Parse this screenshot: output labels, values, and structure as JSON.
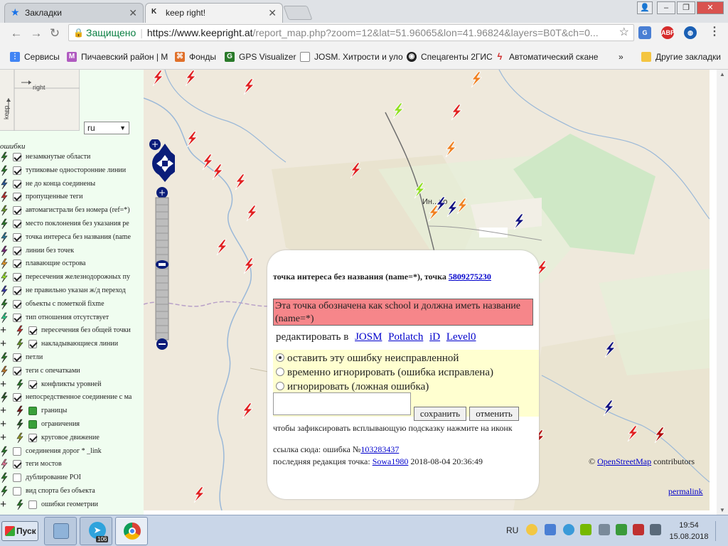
{
  "browser": {
    "tabs": [
      {
        "label": "Закладки",
        "active": false
      },
      {
        "label": "keep right!",
        "active": true
      }
    ],
    "window_controls": [
      "–",
      "❐",
      "✕"
    ],
    "omnibox": {
      "secure_label": "Защищено",
      "url_host": "https://www.keepright.at",
      "url_path": "/report_map.php?zoom=12&lat=51.96065&lon=41.96824&layers=B0T&ch=0..."
    },
    "extensions": [
      "ABP"
    ],
    "bookmarks": [
      {
        "label": "Сервисы",
        "icon": "apps-icon"
      },
      {
        "label": "Пичаевский район | М",
        "icon": "m-icon"
      },
      {
        "label": "Фонды",
        "icon": "funds-icon"
      },
      {
        "label": "GPS Visualizer",
        "icon": "g-icon"
      },
      {
        "label": "JOSM. Хитрости и уло",
        "icon": "doc-icon"
      },
      {
        "label": "Спецагенты 2ГИС",
        "icon": "spy-icon"
      },
      {
        "label": "Автоматический скане",
        "icon": "bolt-icon"
      }
    ],
    "bookmarks_more": "»",
    "other_bookmarks": "Другие закладки"
  },
  "sidebar": {
    "minimap_label": "right",
    "minimap_label2": "keep",
    "language": "ru",
    "errors_header": "ошибки",
    "errors": [
      {
        "label": "незамкнутые области",
        "color": "#2a7a2a",
        "checked": true,
        "plus": false
      },
      {
        "label": "тупиковые односторонние линии",
        "color": "#2a7a2a",
        "checked": true,
        "plus": false
      },
      {
        "label": "не до конца соединены",
        "color": "#2a5a9a",
        "checked": true,
        "plus": false
      },
      {
        "label": "пропущенные теги",
        "color": "#c03030",
        "checked": true,
        "plus": false
      },
      {
        "label": "автомагистрали без номера (ref=*)",
        "color": "#6a9a2a",
        "checked": true,
        "plus": false
      },
      {
        "label": "место поклонения без указания ре",
        "color": "#2a7a2a",
        "checked": true,
        "plus": false
      },
      {
        "label": "точка интереса без названия (name",
        "color": "#2a7a9a",
        "checked": true,
        "plus": false
      },
      {
        "label": "линии без точек",
        "color": "#7a2a7a",
        "checked": true,
        "plus": false
      },
      {
        "label": "плавающие острова",
        "color": "#e89a2a",
        "checked": true,
        "plus": false
      },
      {
        "label": "пересечения железнодорожных пу",
        "color": "#9ae82a",
        "checked": true,
        "plus": false
      },
      {
        "label": "не правильно указан ж/д переход",
        "color": "#3a3aaa",
        "checked": true,
        "plus": false
      },
      {
        "label": "объекты с пометкой fixme",
        "color": "#2a7a2a",
        "checked": true,
        "plus": false
      },
      {
        "label": "тип отношения отсутствует",
        "color": "#2ad08a",
        "checked": true,
        "plus": false
      },
      {
        "label": "пересечения без общей точки",
        "color": "#c03030",
        "checked": true,
        "plus": true
      },
      {
        "label": "накладывающиеся линии",
        "color": "#6a9a2a",
        "checked": true,
        "plus": true
      },
      {
        "label": "петли",
        "color": "#2a7a2a",
        "checked": true,
        "plus": false
      },
      {
        "label": "теги с опечатками",
        "color": "#c07a2a",
        "checked": true,
        "plus": false
      },
      {
        "label": "конфликты уровней",
        "color": "#2a7a2a",
        "checked": true,
        "plus": true
      },
      {
        "label": "непосредственное соединение с ма",
        "color": "#2a5a2a",
        "checked": true,
        "plus": false
      },
      {
        "label": "границы",
        "color": "#7a1a1a",
        "checked": true,
        "plus": true,
        "filled": true
      },
      {
        "label": "ограничения",
        "color": "#2a5a2a",
        "checked": true,
        "plus": true,
        "filled": true
      },
      {
        "label": "круговое движение",
        "color": "#9aa02a",
        "checked": true,
        "plus": true
      },
      {
        "label": "соединения дорог * _link",
        "color": "#2a7a2a",
        "checked": false,
        "plus": false
      },
      {
        "label": "теги мостов",
        "color": "#e87a9a",
        "checked": true,
        "plus": false
      },
      {
        "label": "дублирование POI",
        "color": "#2a7a2a",
        "checked": false,
        "plus": false
      },
      {
        "label": "вид спорта без объекта",
        "color": "#2a7a2a",
        "checked": false,
        "plus": false
      },
      {
        "label": "ошибки геометрии",
        "color": "#2a7a2a",
        "checked": false,
        "plus": true
      }
    ]
  },
  "map": {
    "place_label": "Ин...но",
    "copyright_prefix": "© ",
    "copyright_link": "OpenStreetMap",
    "copyright_suffix": " contributors",
    "permalink": "permalink"
  },
  "popup": {
    "title_prefix": "точка интереса без названия (name=*), точка ",
    "title_link": "5809275230",
    "message": "Эта точка обозначена как school и должна иметь название (name=*)",
    "edit_prefix": "редактировать в",
    "editors": [
      "JOSM",
      "Potlatch",
      "iD",
      "Level0"
    ],
    "options": [
      {
        "label": "оставить эту ошибку неисправленной",
        "selected": true
      },
      {
        "label": "временно игнорировать (ошибка исправлена)",
        "selected": false
      },
      {
        "label": "игнорировать (ложная ошибка)",
        "selected": false
      }
    ],
    "save_label": "сохранить",
    "cancel_label": "отменить",
    "hint": "чтобы зафиксировать всплывающую подсказку нажмите на иконк",
    "link_prefix": "ссылка сюда: ошибка №",
    "link_id": "103283437",
    "last_prefix": "последняя редакция точка: ",
    "last_user": "Sowa1980",
    "last_date": " 2018-08-04 20:36:49"
  },
  "taskbar": {
    "start_label": "Пуск",
    "apps": [
      "paint-app",
      "telegram-app",
      "chrome-app"
    ],
    "telegram_badge": "106",
    "language": "RU",
    "time": "19:54",
    "date": "15.08.2018"
  },
  "colors": {
    "bug_red": "#e02020",
    "bug_dark_red": "#b00000",
    "bug_blue": "#101080",
    "bug_orange": "#f08020",
    "bug_green": "#90e020"
  }
}
